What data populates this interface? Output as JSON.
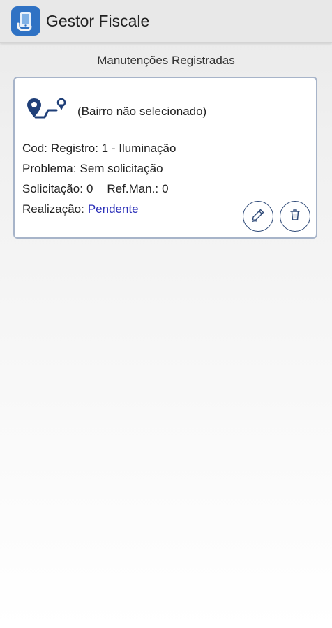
{
  "app": {
    "title": "Gestor Fiscale",
    "icon": "app-logo-icon"
  },
  "page": {
    "section_title": "Manutenções Registradas"
  },
  "card": {
    "icon": "route-pin-icon",
    "bairro": "(Bairro não selecionado)",
    "cod_label": "Cod:",
    "cod_value": "Registro: 1 - Iluminação",
    "problema_label": "Problema:",
    "problema_value": "Sem solicitação",
    "solicitacao_label": "Solicitação:",
    "solicitacao_value": "0",
    "refman_label": "Ref.Man.:",
    "refman_value": "0",
    "realizacao_label": "Realização:",
    "realizacao_value": "Pendente",
    "edit_icon": "pencil-icon",
    "delete_icon": "trash-icon"
  },
  "colors": {
    "accent": "#2f72c4",
    "status_pending": "#2b2fb8",
    "icon_dark": "#2f4a78"
  }
}
